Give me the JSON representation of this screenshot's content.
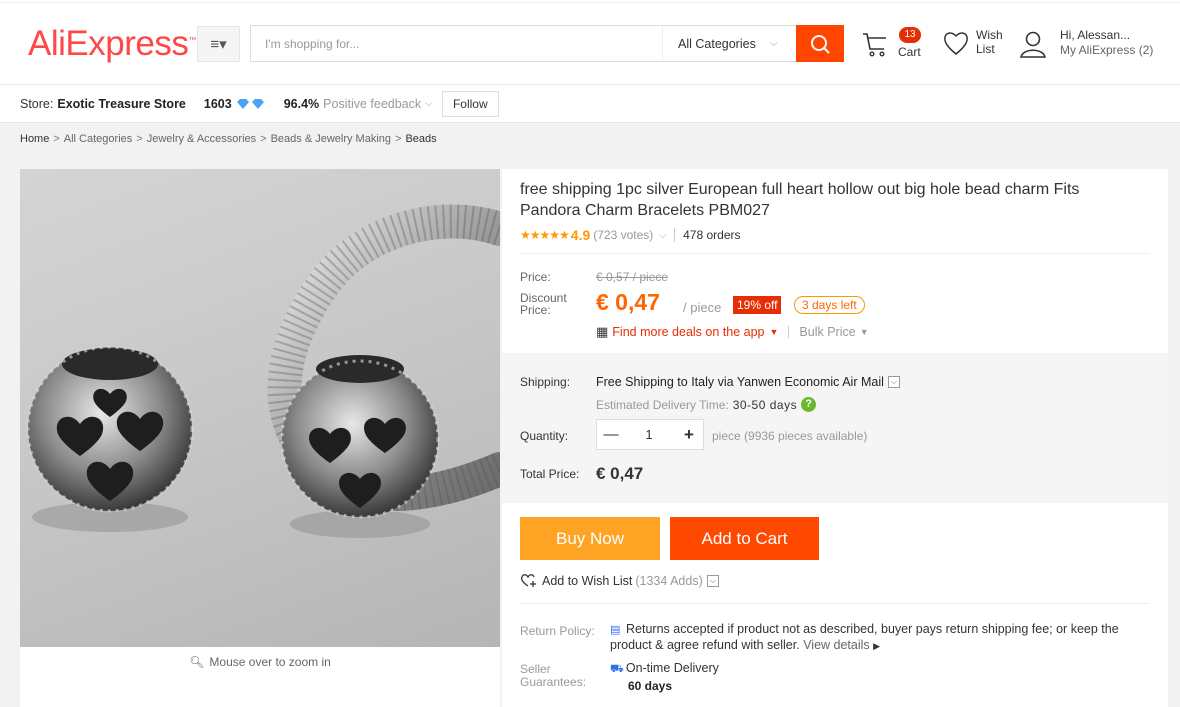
{
  "header": {
    "logo": "AliExpress",
    "logo_tm": "™",
    "search_placeholder": "I'm shopping for...",
    "search_category": "All Categories",
    "cart_count": "13",
    "cart_label": "Cart",
    "wish_label_1": "Wish",
    "wish_label_2": "List",
    "account_greeting": "Hi, Alessan...",
    "account_link": "My AliExpress",
    "account_count": "(2)"
  },
  "store": {
    "label": "Store:",
    "name": "Exotic Treasure Store",
    "score": "1603",
    "feedback_pct": "96.4%",
    "feedback_label": "Positive feedback",
    "follow": "Follow"
  },
  "breadcrumb": [
    "Home",
    "All Categories",
    "Jewelry & Accessories",
    "Beads & Jewelry Making",
    "Beads"
  ],
  "gallery": {
    "zoom_hint": "Mouse over to zoom in"
  },
  "product": {
    "title": "free shipping 1pc silver European full heart hollow out big hole bead charm Fits Pandora Charm Bracelets PBM027",
    "rating": "4.9",
    "votes": "(723 votes)",
    "orders": "478 orders",
    "price_label": "Price:",
    "original_price": "€ 0,57 / piece",
    "discount_label": "Discount Price:",
    "discount_price": "€ 0,47",
    "unit": "/ piece",
    "off_badge": "19% off",
    "days_left": "3 days left",
    "deals_link": "Find more deals on the app",
    "bulk_price": "Bulk Price",
    "shipping_label": "Shipping:",
    "shipping_method": "Free Shipping to Italy via Yanwen Economic Air Mail",
    "eta_label": "Estimated Delivery Time:",
    "eta_days": "30-50 days",
    "quantity_label": "Quantity:",
    "quantity_value": "1",
    "quantity_available": "piece (9936 pieces available)",
    "total_label": "Total Price:",
    "total_value": "€ 0,47",
    "buy_now": "Buy Now",
    "add_to_cart": "Add to Cart",
    "wishlist": "Add to Wish List",
    "wishlist_count": "(1334 Adds)",
    "return_label": "Return Policy:",
    "return_text": "Returns accepted if product not as described, buyer pays return shipping fee; or keep the product & agree refund with seller.",
    "return_more": "View details",
    "guarantee_label": "Seller Guarantees:",
    "guarantee_text": "On-time Delivery",
    "guarantee_days": "60 days"
  },
  "colors": {
    "brand": "#ff4747",
    "search_button": "#ff4500",
    "price": "#ff6600",
    "buy_now": "#ffa324",
    "add_to_cart": "#ff4800"
  }
}
